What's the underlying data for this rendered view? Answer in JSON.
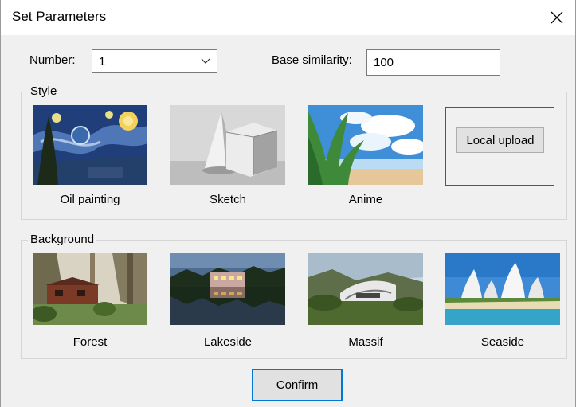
{
  "window": {
    "title": "Set Parameters"
  },
  "number": {
    "label": "Number:",
    "value": "1"
  },
  "similarity": {
    "label": "Base similarity:",
    "value": "100"
  },
  "style_group": {
    "title": "Style",
    "items": [
      {
        "label": "Oil painting"
      },
      {
        "label": "Sketch"
      },
      {
        "label": "Anime"
      }
    ],
    "upload_label": "Local upload"
  },
  "background_group": {
    "title": "Background",
    "items": [
      {
        "label": "Forest"
      },
      {
        "label": "Lakeside"
      },
      {
        "label": "Massif"
      },
      {
        "label": "Seaside"
      }
    ]
  },
  "confirm_label": "Confirm",
  "colors": {
    "accent": "#0078d7",
    "dialog_bg": "#f0f0f0"
  }
}
